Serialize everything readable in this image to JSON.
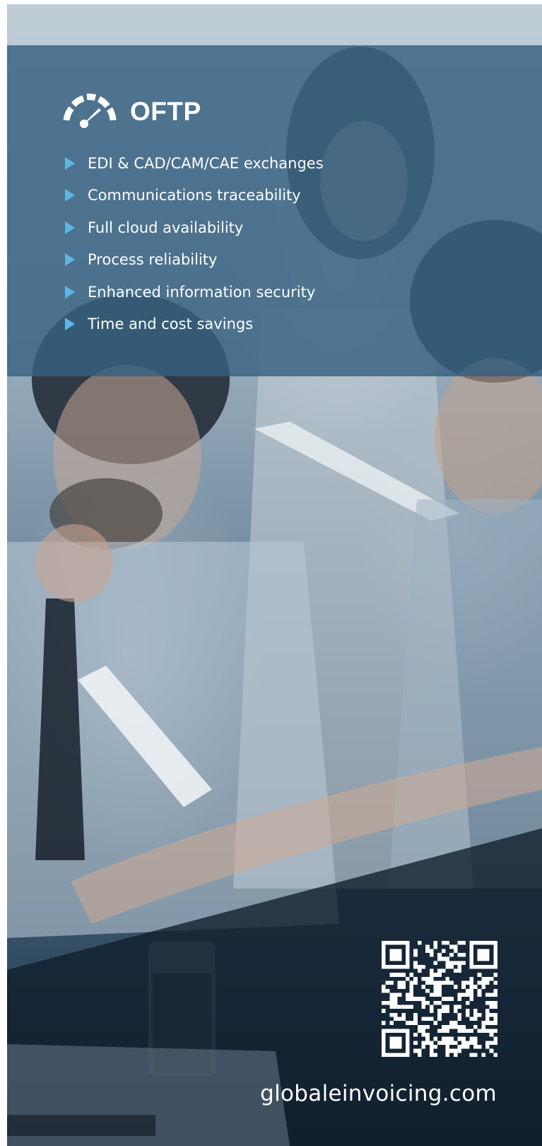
{
  "brand": {
    "title": "OFTP",
    "icon": "speedometer-icon"
  },
  "features": [
    "EDI & CAD/CAM/CAE exchanges",
    "Communications traceability",
    "Full cloud availability",
    "Process reliability",
    "Enhanced information security",
    "Time and cost savings"
  ],
  "footer": {
    "website": "globaleinvoicing.com",
    "qr_icon": "qr-code-icon"
  },
  "colors": {
    "panel": "#366080",
    "bullet": "#5fb6e3",
    "text": "#ffffff"
  }
}
